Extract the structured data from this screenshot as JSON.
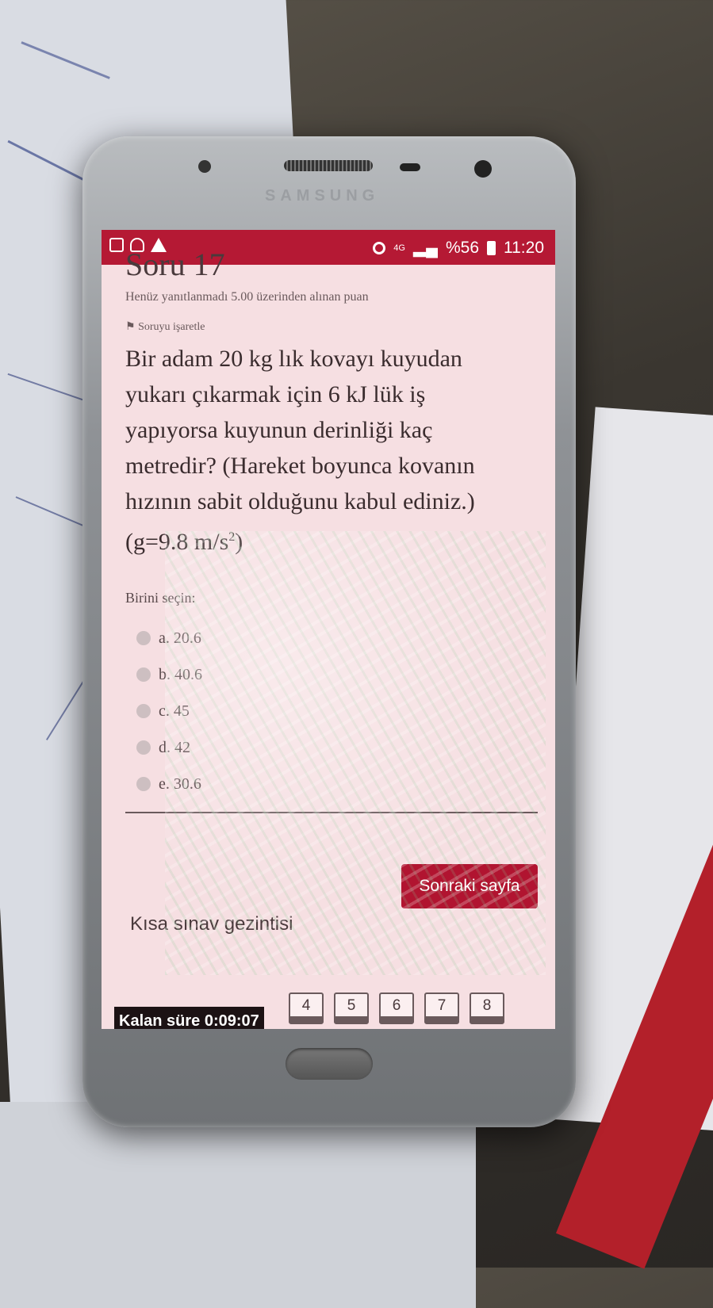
{
  "status_bar": {
    "network": "4G",
    "battery": "%56",
    "time": "11:20"
  },
  "device_brand": "SAMSUNG",
  "question": {
    "header": "Soru 17",
    "state": "Henüz yanıtlanmadı  5.00 üzerinden alınan puan",
    "flag_label": "Soruyu işaretle",
    "text": "Bir adam 20 kg lık kovayı kuyudan yukarı çıkarmak için 6 kJ lük iş yapıyorsa kuyunun derinliği kaç metredir? (Hareket boyunca kovanın hızının sabit olduğunu kabul ediniz.) (g=9.8 m/s",
    "text_sup": "2",
    "text_end": ")"
  },
  "answer": {
    "prompt": "Birini seçin:",
    "options": [
      "a. 20.6",
      "b. 40.6",
      "c. 45",
      "d. 42",
      "e. 30.6"
    ]
  },
  "next_button": "Sonraki sayfa",
  "quiz_nav": {
    "title": "Kısa sınav gezintisi",
    "timer": "Kalan süre 0:09:07",
    "pages": [
      "4",
      "5",
      "6",
      "7",
      "8"
    ]
  }
}
